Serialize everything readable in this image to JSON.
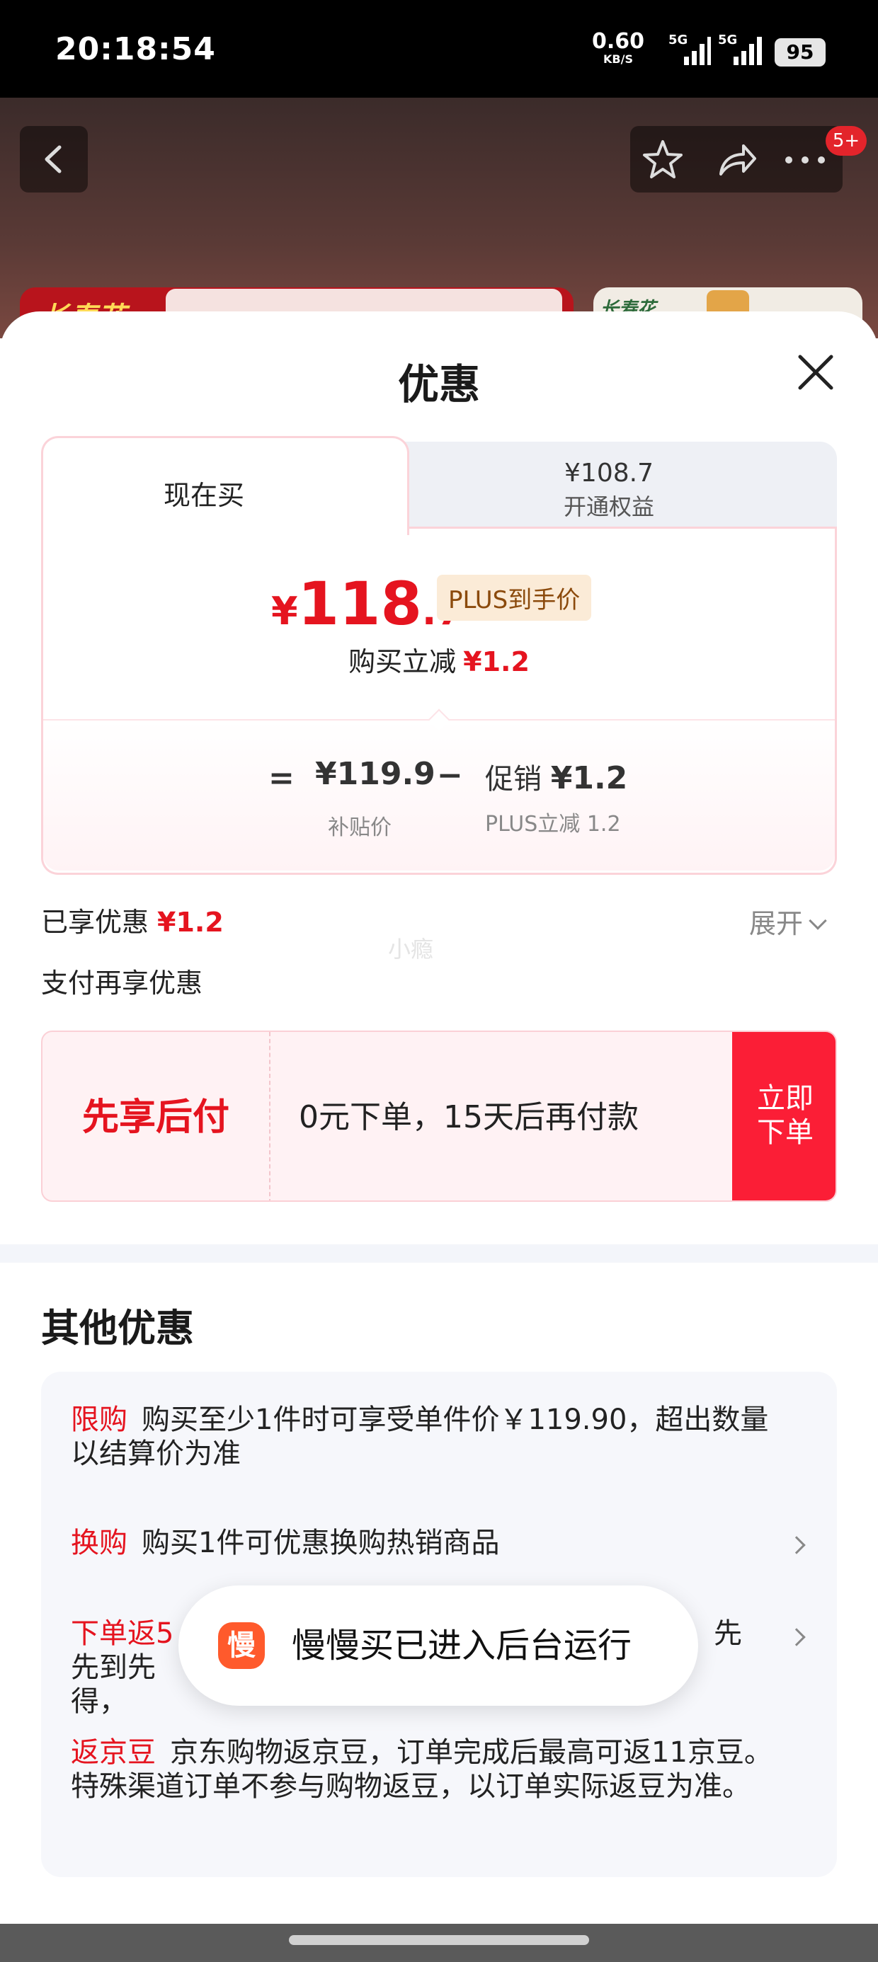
{
  "status_bar": {
    "time": "20:18:54",
    "net_speed": "0.60",
    "net_unit": "KB/S",
    "signal1": "5G",
    "signal2": "5G",
    "battery": "95"
  },
  "background_page": {
    "badge": "5+",
    "banner_left_logo": "长寿花",
    "banner_right_logo": "长寿花"
  },
  "sheet": {
    "title": "优惠"
  },
  "price_card": {
    "tab_active": "现在买",
    "tab_inactive_price": "¥108.7",
    "tab_inactive_label": "开通权益",
    "currency": "¥",
    "price_int": "118",
    "price_dec": ".7",
    "plus_tag": "PLUS到手价",
    "reduce_label": "购买立减",
    "reduce_value": "¥1.2",
    "equals": "=",
    "subsidy_price": "¥119.9",
    "subsidy_label": "补贴价",
    "minus": "−",
    "promo_label": "促销",
    "promo_value": "¥1.2",
    "promo_sub": "PLUS立减 1.2"
  },
  "enjoyed": {
    "label": "已享优惠",
    "value": "¥1.2",
    "expand": "展开"
  },
  "watermark": "小瘾",
  "pay_more": "支付再享优惠",
  "pay_later": {
    "title": "先享后付",
    "desc": "0元下单，15天后再付款",
    "button": "立即下单"
  },
  "other": {
    "title": "其他优惠",
    "deals": [
      {
        "tag": "限购",
        "text": "购买至少1件时可享受单件价￥119.90，超出数量以结算价为准"
      },
      {
        "tag": "换购",
        "text": "购买1件可优惠换购热销商品"
      },
      {
        "tag": "下单返5",
        "text": "先到先得，"
      },
      {
        "tag": "返京豆",
        "text": "京东购物返京豆，订单完成后最高可返11京豆。特殊渠道订单不参与购物返豆，以订单实际返豆为准。"
      }
    ]
  },
  "toast": {
    "icon_char": "慢",
    "text": "慢慢买已进入后台运行"
  },
  "colors": {
    "accent_red": "#e5141f",
    "button_red": "#fb1e36",
    "plus_tag_bg": "#fbebd7",
    "toast_icon": "#ff5a2c"
  }
}
